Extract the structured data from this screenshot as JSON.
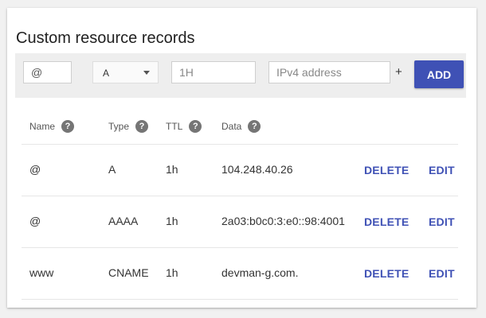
{
  "panel": {
    "title": "Custom resource records"
  },
  "form": {
    "name_value": "@",
    "type_selected": "A",
    "ttl_placeholder": "1H",
    "data_placeholder": "IPv4 address",
    "plus_label": "+",
    "add_label": "ADD"
  },
  "table": {
    "headers": {
      "name": "Name",
      "type": "Type",
      "ttl": "TTL",
      "data": "Data"
    },
    "help_glyph": "?",
    "delete_label": "DELETE",
    "edit_label": "EDIT",
    "rows": [
      {
        "name": "@",
        "type": "A",
        "ttl": "1h",
        "data": "104.248.40.26"
      },
      {
        "name": "@",
        "type": "AAAA",
        "ttl": "1h",
        "data": "2a03:b0c0:3:e0::98:4001"
      },
      {
        "name": "www",
        "type": "CNAME",
        "ttl": "1h",
        "data": "devman-g.com."
      }
    ]
  },
  "colors": {
    "accent": "#3f51b5",
    "toolbar_bg": "#eeeeee",
    "help_icon": "#757575"
  }
}
